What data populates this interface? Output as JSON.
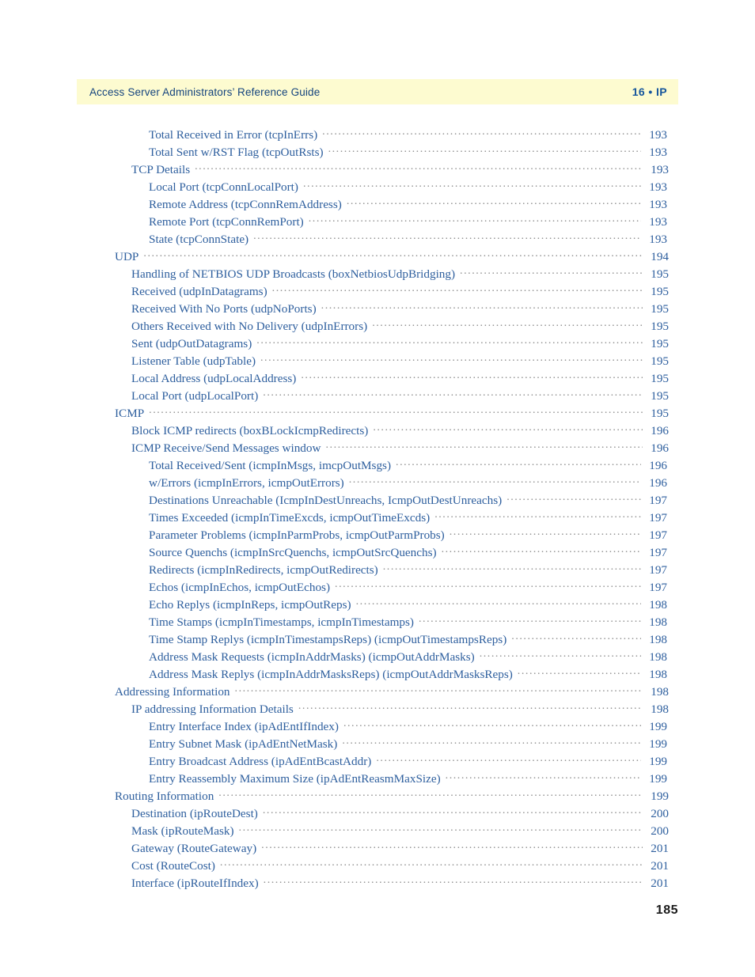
{
  "header": {
    "title": "Access Server Administrators’ Reference Guide",
    "chapter": "16 • IP"
  },
  "folio": "185",
  "toc": {
    "entries": [
      {
        "level": 3,
        "label": "Total Received in Error (tcpInErrs)",
        "page": "193"
      },
      {
        "level": 3,
        "label": "Total Sent w/RST Flag (tcpOutRsts)",
        "page": "193"
      },
      {
        "level": 2,
        "label": "TCP Details",
        "page": "193"
      },
      {
        "level": 3,
        "label": "Local Port (tcpConnLocalPort)",
        "page": "193"
      },
      {
        "level": 3,
        "label": "Remote Address (tcpConnRemAddress)",
        "page": "193"
      },
      {
        "level": 3,
        "label": "Remote Port (tcpConnRemPort)",
        "page": "193"
      },
      {
        "level": 3,
        "label": "State (tcpConnState)",
        "page": "193"
      },
      {
        "level": 1,
        "label": "UDP",
        "page": "194"
      },
      {
        "level": 2,
        "label": "Handling of NETBIOS UDP Broadcasts (boxNetbiosUdpBridging)",
        "page": "195"
      },
      {
        "level": 2,
        "label": "Received (udpInDatagrams)",
        "page": "195"
      },
      {
        "level": 2,
        "label": "Received With No Ports (udpNoPorts)",
        "page": "195"
      },
      {
        "level": 2,
        "label": "Others Received with No Delivery (udpInErrors)",
        "page": "195"
      },
      {
        "level": 2,
        "label": "Sent (udpOutDatagrams)",
        "page": "195"
      },
      {
        "level": 2,
        "label": "Listener Table (udpTable)",
        "page": "195"
      },
      {
        "level": 2,
        "label": "Local Address (udpLocalAddress)",
        "page": "195"
      },
      {
        "level": 2,
        "label": "Local Port (udpLocalPort)",
        "page": "195"
      },
      {
        "level": 1,
        "label": "ICMP",
        "page": "195"
      },
      {
        "level": 2,
        "label": "Block ICMP redirects (boxBLockIcmpRedirects)",
        "page": "196"
      },
      {
        "level": 2,
        "label": "ICMP Receive/Send Messages window",
        "page": "196"
      },
      {
        "level": 3,
        "label": "Total Received/Sent (icmpInMsgs, imcpOutMsgs)",
        "page": "196"
      },
      {
        "level": 3,
        "label": "w/Errors (icmpInErrors, icmpOutErrors)",
        "page": "196"
      },
      {
        "level": 3,
        "label": "Destinations Unreachable (IcmpInDestUnreachs, IcmpOutDestUnreachs)",
        "page": "197"
      },
      {
        "level": 3,
        "label": "Times Exceeded (icmpInTimeExcds, icmpOutTimeExcds)",
        "page": "197"
      },
      {
        "level": 3,
        "label": "Parameter Problems (icmpInParmProbs, icmpOutParmProbs)",
        "page": "197"
      },
      {
        "level": 3,
        "label": "Source Quenchs (icmpInSrcQuenchs, icmpOutSrcQuenchs)",
        "page": "197"
      },
      {
        "level": 3,
        "label": "Redirects (icmpInRedirects, icmpOutRedirects)",
        "page": "197"
      },
      {
        "level": 3,
        "label": "Echos (icmpInEchos, icmpOutEchos)",
        "page": "197"
      },
      {
        "level": 3,
        "label": "Echo Replys (icmpInReps, icmpOutReps)",
        "page": "198"
      },
      {
        "level": 3,
        "label": "Time Stamps (icmpInTimestamps, icmpInTimestamps)",
        "page": "198"
      },
      {
        "level": 3,
        "label": "Time Stamp Replys (icmpInTimestampsReps) (icmpOutTimestampsReps)",
        "page": "198"
      },
      {
        "level": 3,
        "label": "Address Mask Requests (icmpInAddrMasks) (icmpOutAddrMasks)",
        "page": "198"
      },
      {
        "level": 3,
        "label": "Address Mask Replys (icmpInAddrMasksReps) (icmpOutAddrMasksReps)",
        "page": "198"
      },
      {
        "level": 1,
        "label": "Addressing Information",
        "page": "198"
      },
      {
        "level": 2,
        "label": "IP addressing Information Details",
        "page": "198"
      },
      {
        "level": 3,
        "label": "Entry Interface Index (ipAdEntIfIndex)",
        "page": "199"
      },
      {
        "level": 3,
        "label": "Entry Subnet Mask (ipAdEntNetMask)",
        "page": "199"
      },
      {
        "level": 3,
        "label": "Entry Broadcast Address (ipAdEntBcastAddr)",
        "page": "199"
      },
      {
        "level": 3,
        "label": "Entry Reassembly Maximum Size (ipAdEntReasmMaxSize)",
        "page": "199"
      },
      {
        "level": 1,
        "label": "Routing Information",
        "page": "199"
      },
      {
        "level": 2,
        "label": "Destination (ipRouteDest)",
        "page": "200"
      },
      {
        "level": 2,
        "label": "Mask (ipRouteMask)",
        "page": "200"
      },
      {
        "level": 2,
        "label": "Gateway (RouteGateway)",
        "page": "201"
      },
      {
        "level": 2,
        "label": "Cost (RouteCost)",
        "page": "201"
      },
      {
        "level": 2,
        "label": "Interface (ipRouteIfIndex)",
        "page": "201"
      }
    ]
  }
}
